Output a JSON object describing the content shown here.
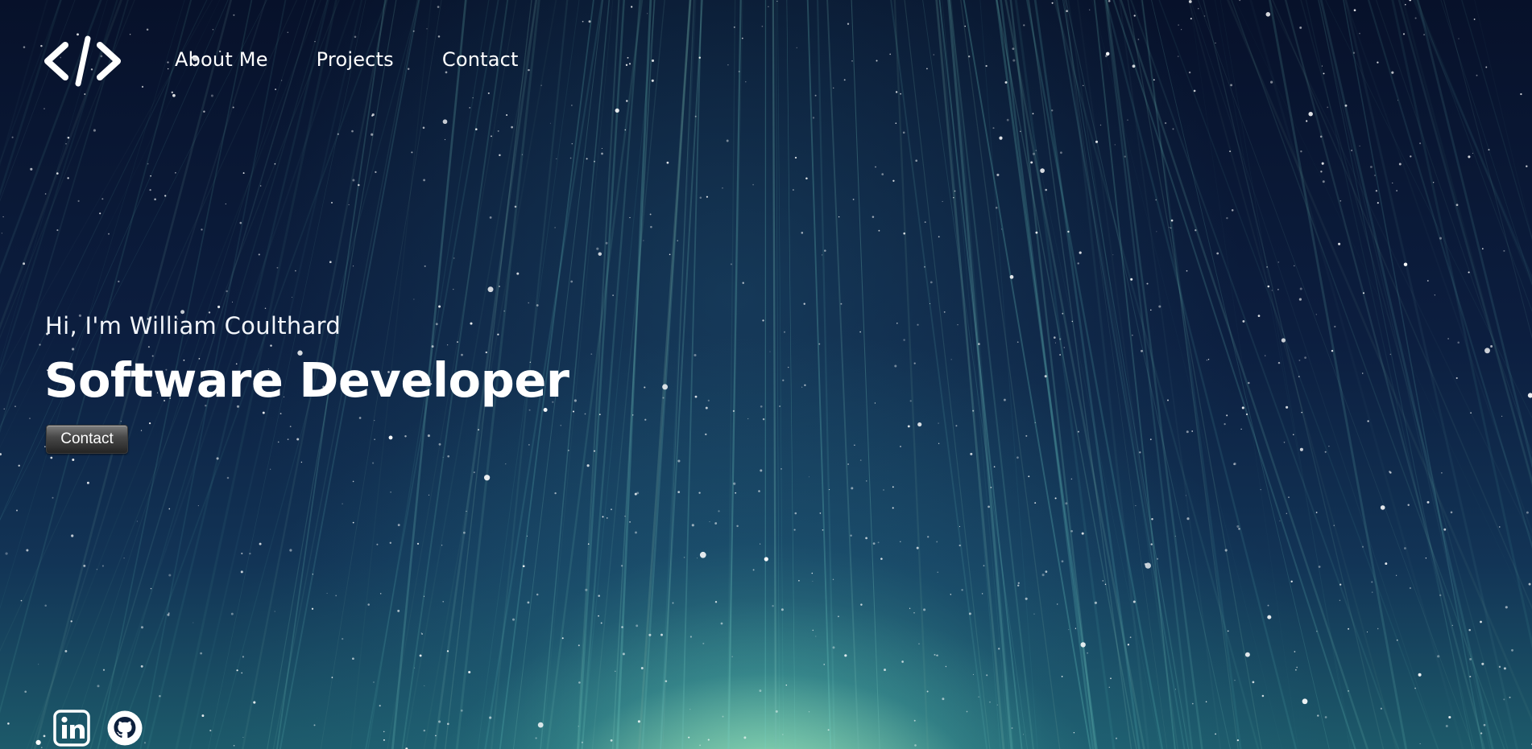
{
  "header": {
    "logo_icon": "code-brackets-icon",
    "nav": {
      "items": [
        {
          "label": "About Me"
        },
        {
          "label": "Projects"
        },
        {
          "label": "Contact"
        }
      ]
    }
  },
  "hero": {
    "greeting": "Hi, I'm William Coulthard",
    "title": "Software Developer",
    "contact_button_label": "Contact"
  },
  "social": {
    "linkedin_icon": "linkedin-icon",
    "github_icon": "github-icon"
  },
  "colors": {
    "text": "#ffffff",
    "background_top": "#07112a",
    "background_glow": "#bff5c8",
    "button_bg": "#3a3a3a"
  }
}
